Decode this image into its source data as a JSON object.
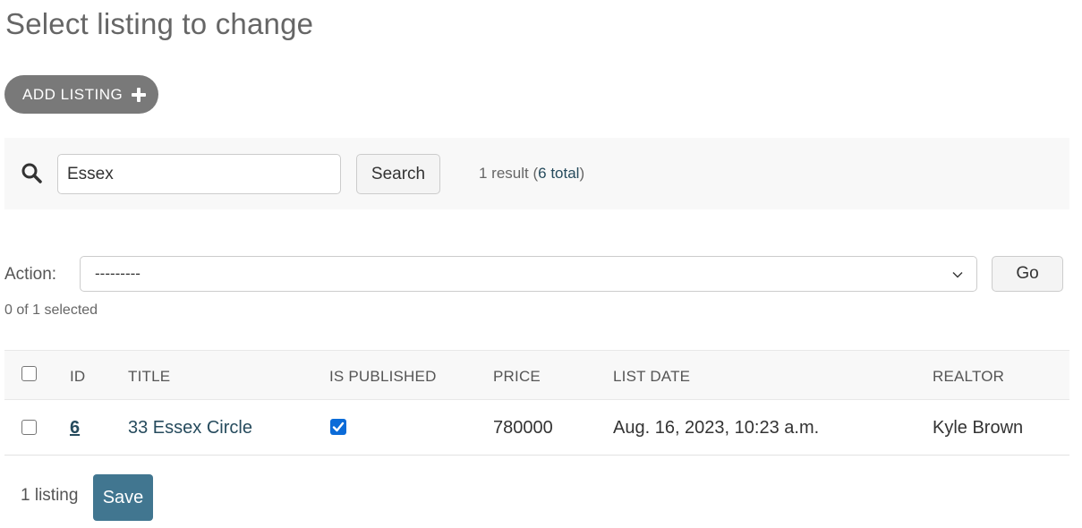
{
  "page": {
    "title": "Select listing to change"
  },
  "object_tools": {
    "add_label": "ADD LISTING"
  },
  "search": {
    "value": "Essex",
    "button_label": "Search",
    "result_text": "1 result (",
    "total_link": "6 total",
    "result_close": ")"
  },
  "actions": {
    "label": "Action:",
    "selected_option": "---------",
    "go_label": "Go",
    "counter": "0 of 1 selected"
  },
  "table": {
    "headers": [
      "ID",
      "TITLE",
      "IS PUBLISHED",
      "PRICE",
      "LIST DATE",
      "REALTOR"
    ],
    "rows": [
      {
        "id": "6",
        "title": "33 Essex Circle",
        "is_published": true,
        "price": "780000",
        "list_date": "Aug. 16, 2023, 10:23 a.m.",
        "realtor": "Kyle Brown"
      }
    ]
  },
  "footer": {
    "paginator": "1 listing",
    "save_label": "Save"
  },
  "colors": {
    "primary": "#417690",
    "link": "#264b5d",
    "checkbox_checked": "#0b6bd8",
    "toolbar_bg": "#f8f8f8"
  }
}
